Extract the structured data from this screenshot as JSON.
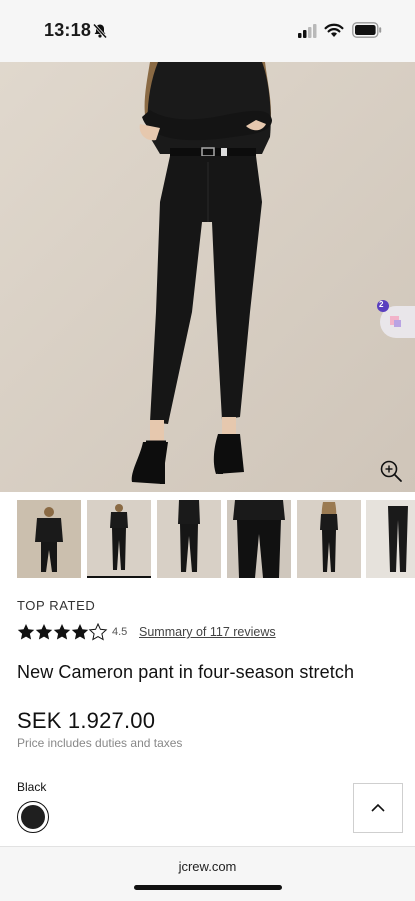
{
  "status_bar": {
    "time": "13:18"
  },
  "product": {
    "badge": "TOP RATED",
    "rating": "4.5",
    "rating_stars": 4.5,
    "reviews_link": "Summary of 117 reviews",
    "title": "New Cameron pant in four-season stretch",
    "price": "SEK 1.927.00",
    "price_note": "Price includes duties and taxes",
    "color_label": "Black",
    "color_hex": "#1f1f1f"
  },
  "promo": {
    "count": "2"
  },
  "gallery": {
    "thumbnails": [
      "thumbnail-1",
      "thumbnail-2",
      "thumbnail-3",
      "thumbnail-4",
      "thumbnail-5",
      "thumbnail-6"
    ],
    "active_index": 1
  },
  "browser": {
    "url": "jcrew.com"
  }
}
